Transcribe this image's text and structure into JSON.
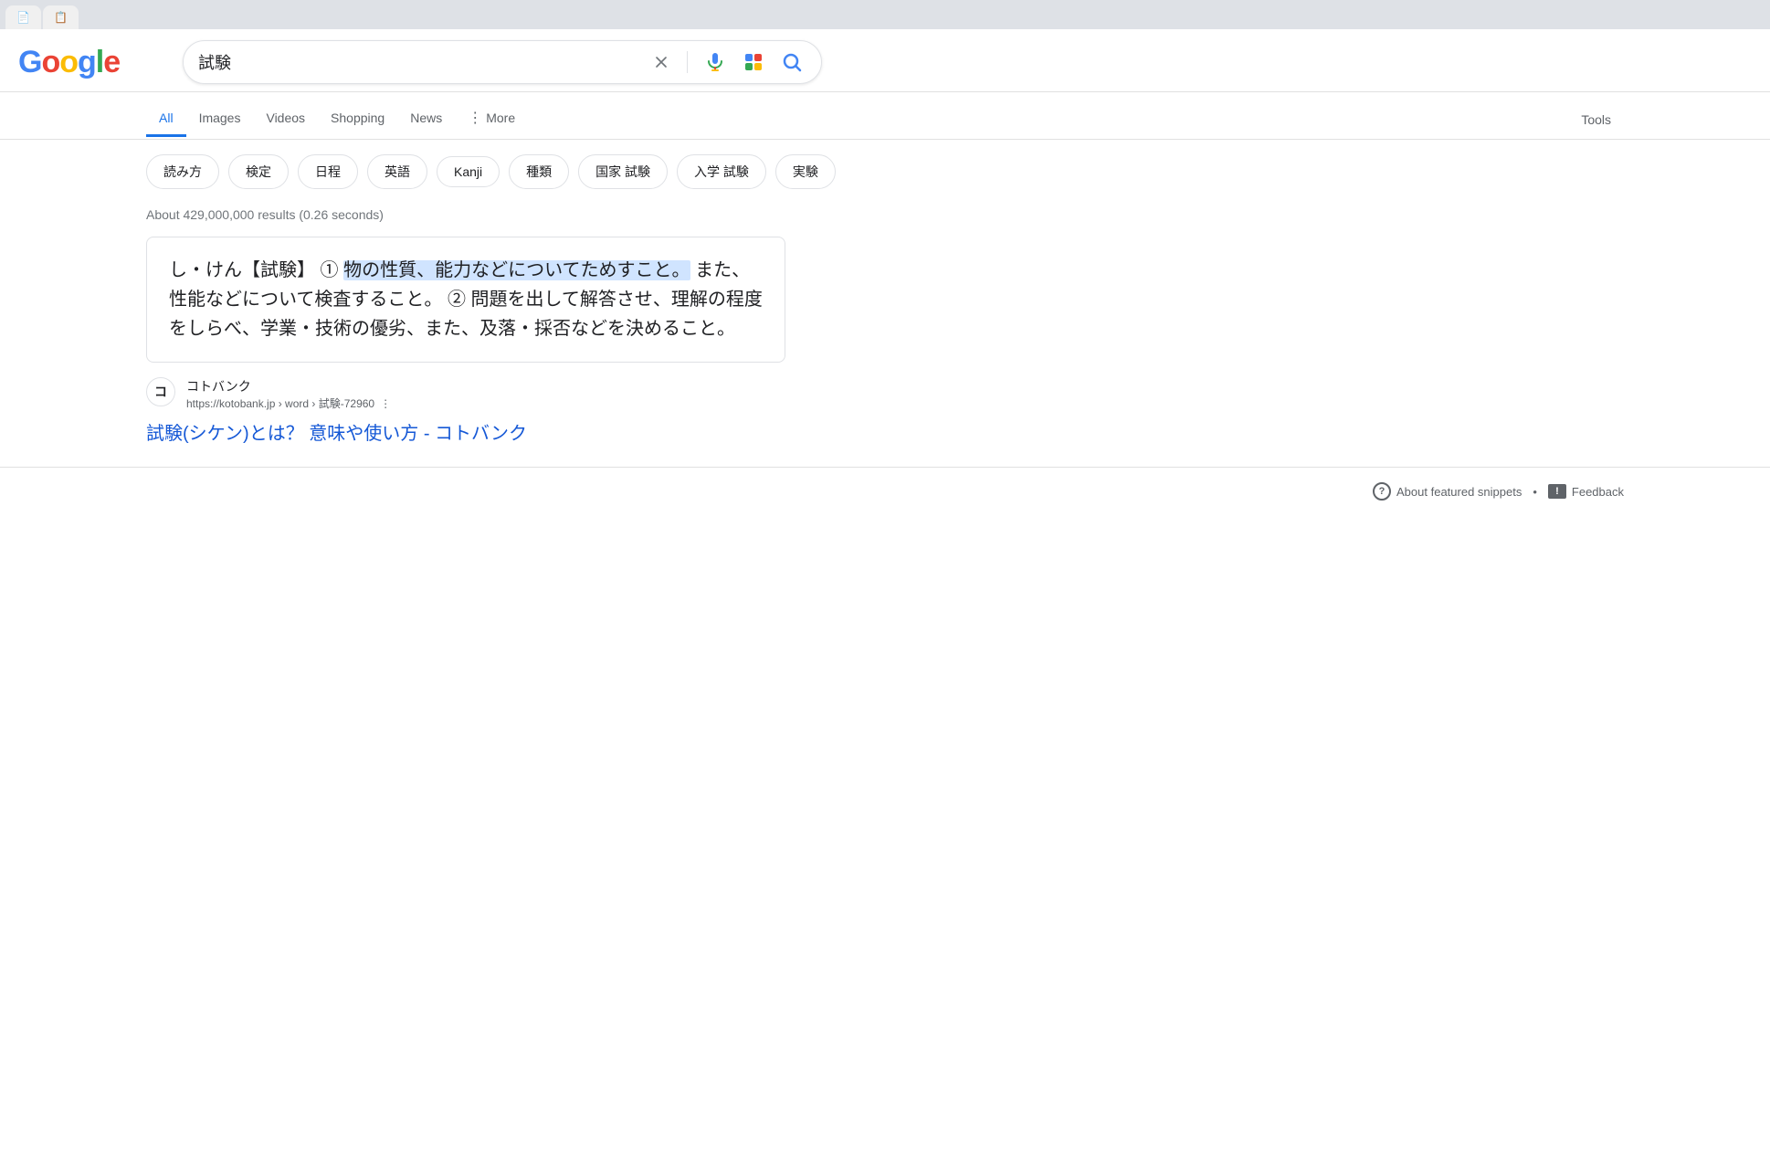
{
  "browser": {
    "tabs": [
      {
        "icon": "📄",
        "label": ""
      },
      {
        "icon": "📋",
        "label": ""
      }
    ]
  },
  "header": {
    "logo": {
      "g1": "G",
      "o1": "o",
      "o2": "o",
      "g2": "g",
      "l": "l",
      "e": "e"
    },
    "search": {
      "query": "試験",
      "clear_label": "×",
      "voice_label": "音声検索",
      "lens_label": "Googleレンズ",
      "search_label": "Google検索"
    }
  },
  "nav": {
    "tabs": [
      {
        "label": "All",
        "active": true
      },
      {
        "label": "Images",
        "active": false
      },
      {
        "label": "Videos",
        "active": false
      },
      {
        "label": "Shopping",
        "active": false
      },
      {
        "label": "News",
        "active": false
      },
      {
        "label": "More",
        "active": false
      }
    ],
    "tools_label": "Tools"
  },
  "chips": {
    "items": [
      {
        "label": "読み方"
      },
      {
        "label": "検定"
      },
      {
        "label": "日程"
      },
      {
        "label": "英語"
      },
      {
        "label": "Kanji"
      },
      {
        "label": "種類"
      },
      {
        "label": "国家 試験"
      },
      {
        "label": "入学 試験"
      },
      {
        "label": "実験"
      }
    ]
  },
  "results": {
    "count_text": "About 429,000,000 results (0.26 seconds)"
  },
  "featured_snippet": {
    "text_before_highlight": "し・けん【試験】 ① ",
    "text_highlight": "物の性質、能力などについてためすこと。",
    "text_after": " また、性能などについて検査すること。 ② 問題を出して解答させ、理解の程度をしらべ、学業・技術の優劣、また、及落・採否などを決めること。"
  },
  "source": {
    "favicon_text": "コ",
    "name": "コトバンク",
    "url": "https://kotobank.jp › word › 試験-72960",
    "more_label": "⋮"
  },
  "result_link": {
    "text": "試験(シケン)とは？ 意味や使い方 - コトバンク"
  },
  "footer": {
    "about_label": "About featured snippets",
    "separator": "•",
    "feedback_label": "Feedback",
    "question_icon": "?",
    "feedback_icon": "!"
  }
}
